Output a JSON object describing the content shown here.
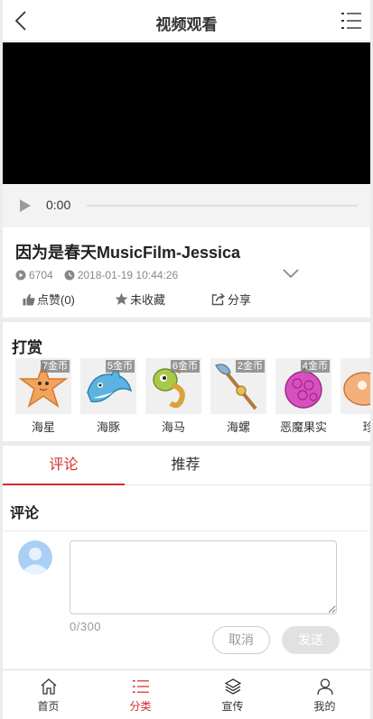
{
  "header": {
    "title": "视频观看",
    "back_icon": "back-arrow-icon",
    "menu_icon": "list-menu-icon"
  },
  "player": {
    "time": "0:00"
  },
  "video": {
    "title": "因为是春天MusicFilm-Jessica",
    "views": "6704",
    "published": "2018-01-19 10:44:26",
    "like_label": "点赞(0)",
    "collect_label": "未收藏",
    "share_label": "分享"
  },
  "reward": {
    "title": "打赏",
    "gifts": [
      {
        "name": "海星",
        "price": "7金币"
      },
      {
        "name": "海豚",
        "price": "5金币"
      },
      {
        "name": "海马",
        "price": "6金币"
      },
      {
        "name": "海螺",
        "price": "2金币"
      },
      {
        "name": "恶魔果实",
        "price": "4金币"
      },
      {
        "name": "珍",
        "price": ""
      }
    ]
  },
  "tabs": [
    {
      "label": "评论",
      "active": true
    },
    {
      "label": "推荐",
      "active": false
    }
  ],
  "comments": {
    "title": "评论",
    "counter": "0/300",
    "cancel_label": "取消",
    "send_label": "发送"
  },
  "tabbar": [
    {
      "label": "首页",
      "icon": "home-icon",
      "active": false
    },
    {
      "label": "分类",
      "icon": "category-icon",
      "active": true
    },
    {
      "label": "宣传",
      "icon": "layers-icon",
      "active": false
    },
    {
      "label": "我的",
      "icon": "user-icon",
      "active": false
    }
  ],
  "colors": {
    "accent": "#d42a2a",
    "video_bg": "#000000",
    "page_bg": "#ececec"
  }
}
